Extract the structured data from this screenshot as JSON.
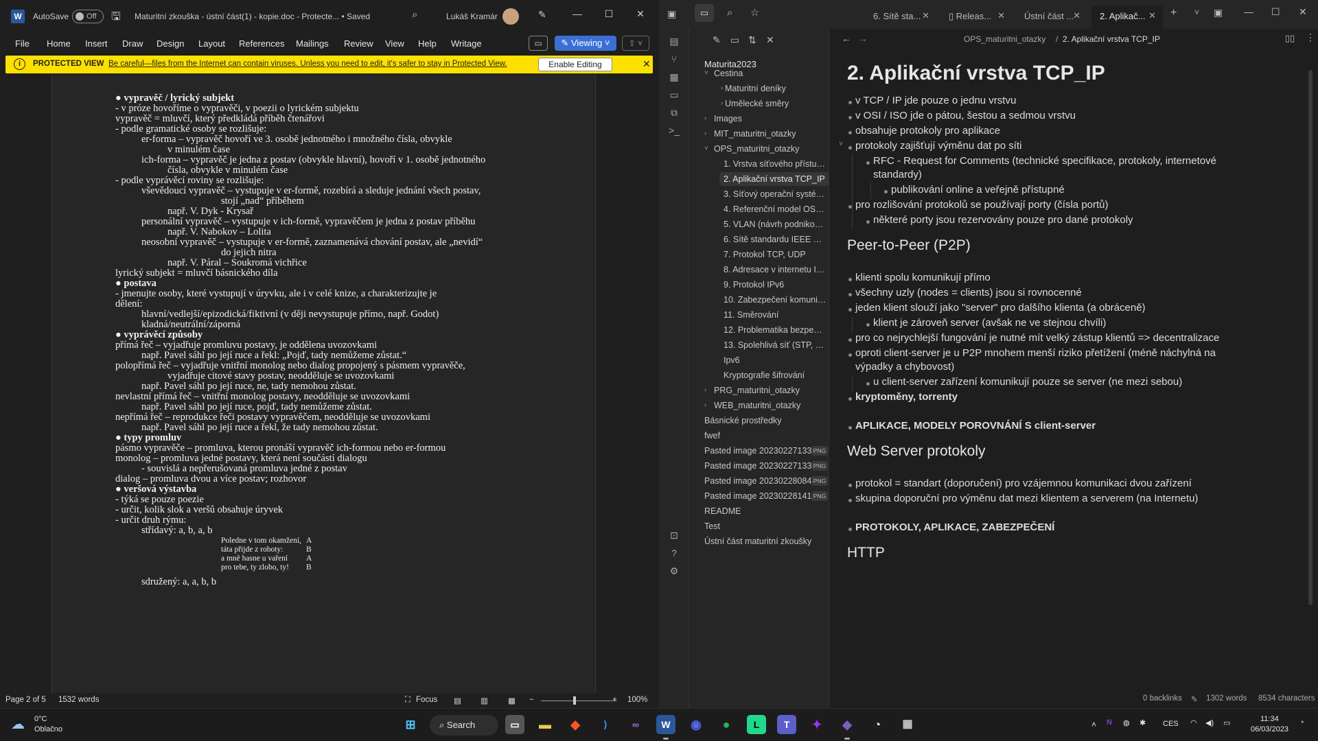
{
  "word": {
    "logo": "W",
    "autosave_label": "AutoSave",
    "autosave_state": "Off",
    "doc_title": "Maturitní zkouška - ústní část(1) - kopie.doc  -  Protecte...  •  Saved",
    "user_name": "Lukáš Kramár",
    "menu": [
      "File",
      "Home",
      "Insert",
      "Draw",
      "Design",
      "Layout",
      "References",
      "Mailings",
      "Review",
      "View",
      "Help",
      "Writage"
    ],
    "viewing_label": "Viewing",
    "protected_label": "PROTECTED VIEW",
    "protected_message": "Be careful—files from the Internet can contain viruses. Unless you need to edit, it's safer to stay in Protected View.",
    "enable_editing": "Enable Editing",
    "status": {
      "page": "Page 2 of 5",
      "words": "1532 words",
      "focus": "Focus",
      "zoom": "100%"
    },
    "doc_lines": [
      "● vypravěč / lyrický subjekt",
      "- v próze hovoříme o vypravěči, v poezii o lyrickém subjektu",
      "vypravěč = mluvčí, který předkládá příběh čtenářovi",
      "- podle gramatické osoby se rozlišuje:",
      "er-forma – vypravěč hovoří ve 3. osobě jednotného i množného čísla, obvykle",
      "v minulém čase",
      "ich-forma – vypravěč je jedna z postav (obvykle hlavní), hovoří v 1. osobě jednotného",
      "čísla, obvykle v minulém čase",
      "- podle vyprávěcí roviny se rozlišuje:",
      "vševědoucí vypravěč – vystupuje v er-formě, rozebírá a sleduje jednání všech postav,",
      "stojí „nad“ příběhem",
      "např. V. Dyk - Krysař",
      "personální vypravěč – vystupuje v ich-formě, vypravěčem je jedna z postav příběhu",
      "např. V. Nabokov – Lolita",
      "neosobní vypravěč – vystupuje v er-formě, zaznamenává chování postav, ale „nevidí“",
      "do jejich nitra",
      "např. V. Páral – Soukromá vichřice",
      "lyrický subjekt = mluvčí básnického díla",
      "● postava",
      "- jmenujte osoby, které vystupují v úryvku, ale i v celé knize, a charakterizujte je",
      "dělení:",
      "hlavní/vedlejší/epizodická/fiktivní (v ději nevystupuje přímo, např. Godot)",
      "kladná/neutrální/záporná",
      "● vyprávěcí způsoby",
      "přímá řeč – vyjadřuje promluvu postavy, je oddělena uvozovkami",
      "např. Pavel sáhl po její ruce a řekl: „Pojď, tady nemůžeme zůstat.“",
      "polopřímá řeč – vyjadřuje vnitřní monolog nebo dialog propojený s pásmem vypravěče,",
      "vyjadřuje citové stavy postav, neodděluje se uvozovkami",
      "např. Pavel sáhl po její ruce, ne, tady nemohou zůstat.",
      "nevlastní přímá řeč – vnitřní monolog postavy, neodděluje se uvozovkami",
      "např. Pavel sáhl po její ruce, pojď, tady nemůžeme zůstat.",
      "nepřímá řeč – reprodukce řeči postavy vypravěčem, neodděluje se uvozovkami",
      "např. Pavel sáhl po její ruce a řekl, že tady nemohou zůstat.",
      "● typy promluv",
      "pásmo vypravěče – promluva, kterou pronáší vypravěč ich-formou nebo er-formou",
      "monolog – promluva jedné postavy, která není součástí dialogu",
      "-     souvislá a nepřerušovaná promluva jedné z postav",
      "dialog – promluva dvou a více postav; rozhovor",
      "● veršová výstavba",
      "- týká se pouze poezie",
      "- určit, kolik slok a veršů obsahuje úryvek",
      "- určit druh rýmu:",
      "střídavý: a, b, a, b",
      "Poledne v tom okamžení,",
      "táta přijde z roboty:",
      "a mně hasne u vaření",
      "pro tebe, ty zlobo, ty!",
      "A",
      "B",
      "A",
      "B",
      "sdružený: a, a, b, b"
    ]
  },
  "obsidian": {
    "tabs": [
      "6. Sítě sta...",
      "Releas...",
      "Ústní část ...",
      "2. Aplikač..."
    ],
    "vault": "Maturita2023",
    "files": [
      "Cestina",
      "Maturitní deníky",
      "Umělecké směry",
      "Images",
      "MIT_maturitni_otazky",
      "OPS_maturitni_otazky",
      "1. Vrstva síťového přístupu (Et...",
      "2. Aplikační vrstva TCP_IP",
      "3. Síťový operační systém Linux",
      "4. Referenční model OSI_ISO a...",
      "5. VLAN (návrh podnikové sítě)",
      "6. Sítě standardu IEEE 802.11",
      "7. Protokol TCP, UDP",
      "8. Adresace v internetu IPv4 (c...",
      "9. Protokol IPv6",
      "10. Zabezpečení komunikace (...",
      "11. Směrování",
      "12. Problematika bezpečnosti ...",
      "13. Spolehlivá síť (STP, Etherc...",
      "Ipv6",
      "Kryptografie šifrování",
      "PRG_maturitni_otazky",
      "WEB_maturitni_otazky",
      "Básnické prostředky",
      "fwef",
      "Pasted image 20230227133...",
      "Pasted image 20230227133...",
      "Pasted image 20230228084...",
      "Pasted image 20230228141...",
      "README",
      "Test",
      "Ústní část maturitní zkoušky"
    ],
    "png_badge": "PNG",
    "breadcrumb_folder": "OPS_maturitni_otazky",
    "breadcrumb_sep": "/",
    "breadcrumb_note": "2. Aplikační vrstva TCP_IP",
    "note": {
      "title": "2. Aplikační vrstva TCP_IP",
      "lines": [
        "v TCP / IP jde pouze o jednu vrstvu",
        "v OSI / ISO jde o pátou, šestou a sedmou vrstvu",
        "obsahuje protokoly pro aplikace",
        "protokoly zajišťují výměnu dat po síti",
        "RFC - Request for Comments (technické specifikace, protokoly, internetové",
        "standardy)",
        "publikování online a veřejně přístupné",
        "pro rozlišování protokolů se používají porty (čísla portů)",
        "některé porty jsou rezervovány pouze pro dané protokoly",
        "Peer-to-Peer (P2P)",
        "klienti spolu komunikují přímo",
        "všechny uzly (nodes = clients) jsou si rovnocenné",
        "jeden klient slouží jako \"server\" pro dalšího klienta (a obráceně)",
        "klient je zároveň server (avšak ne ve stejnou chvíli)",
        "pro co nejrychlejší fungování je nutné mít velký zástup klientů => decentralizace",
        "oproti client-server je u P2P mnohem menší riziko přetížení (méně náchylná na",
        "výpadky a  chybovost)",
        "u client-server zařízení komunikují pouze se server (ne mezi sebou)",
        "kryptoměny, torrenty",
        "APLIKACE, MODELY POROVNÁNÍ S client-server",
        "Web Server protokoly",
        "protokol = standart (doporučení) pro vzájemnou komunikaci dvou zařízení",
        "skupina doporuční pro výměnu dat mezi klientem a serverem (na Internetu)",
        "PROTOKOLY, APLIKACE, ZABEZPEČENÍ",
        "HTTP"
      ]
    },
    "status": {
      "backlinks": "0 backlinks",
      "words": "1302 words",
      "characters": "8534 characters"
    }
  },
  "taskbar": {
    "weather_temp": "0°C",
    "weather_desc": "Oblačno",
    "search": "Search",
    "lang": "CES",
    "time": "11:34",
    "date": "06/03/2023"
  },
  "colors": {
    "word_blue": "#2b579a",
    "viewing_blue": "#3b6fd4",
    "protected_yellow": "#fce100",
    "obsidian_accent": "#7c5cbf"
  }
}
